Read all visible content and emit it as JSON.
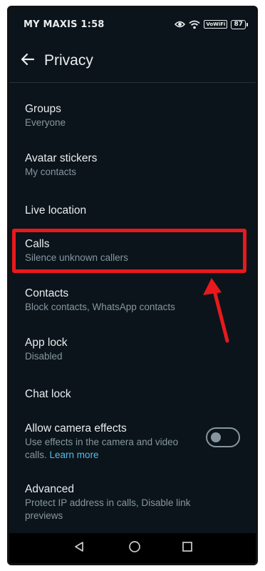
{
  "status_bar": {
    "time": "MY MAXIS 1:58",
    "volte": "VoWiFi",
    "battery": "87",
    "icons": [
      "eye-icon",
      "wifi-icon",
      "volte-badge",
      "battery-icon"
    ]
  },
  "header": {
    "title": "Privacy",
    "back_icon": "arrow-left-icon"
  },
  "items": [
    {
      "id": "groups",
      "title": "Groups",
      "subtitle": "Everyone"
    },
    {
      "id": "avatar-stickers",
      "title": "Avatar stickers",
      "subtitle": "My contacts"
    },
    {
      "id": "live-location",
      "title": "Live location",
      "subtitle": ""
    },
    {
      "id": "calls",
      "title": "Calls",
      "subtitle": "Silence unknown callers"
    },
    {
      "id": "contacts",
      "title": "Contacts",
      "subtitle": "Block contacts, WhatsApp contacts"
    },
    {
      "id": "app-lock",
      "title": "App lock",
      "subtitle": "Disabled"
    },
    {
      "id": "chat-lock",
      "title": "Chat lock",
      "subtitle": ""
    },
    {
      "id": "camera-effects",
      "title": "Allow camera effects",
      "subtitle": "Use effects in the camera and video calls.",
      "link": "Learn more",
      "toggle_on": false
    },
    {
      "id": "advanced",
      "title": "Advanced",
      "subtitle": "Protect IP address in calls, Disable link previews"
    }
  ],
  "annotation": {
    "highlight_color": "#e8191c",
    "highlighted_item": "Calls"
  },
  "nav_bar": {
    "buttons": [
      "back-triangle-icon",
      "home-circle-icon",
      "recents-square-icon"
    ]
  },
  "colors": {
    "background": "#0b141a",
    "primary_text": "#e9edef",
    "secondary_text": "#8696a0",
    "link": "#53bdeb"
  }
}
